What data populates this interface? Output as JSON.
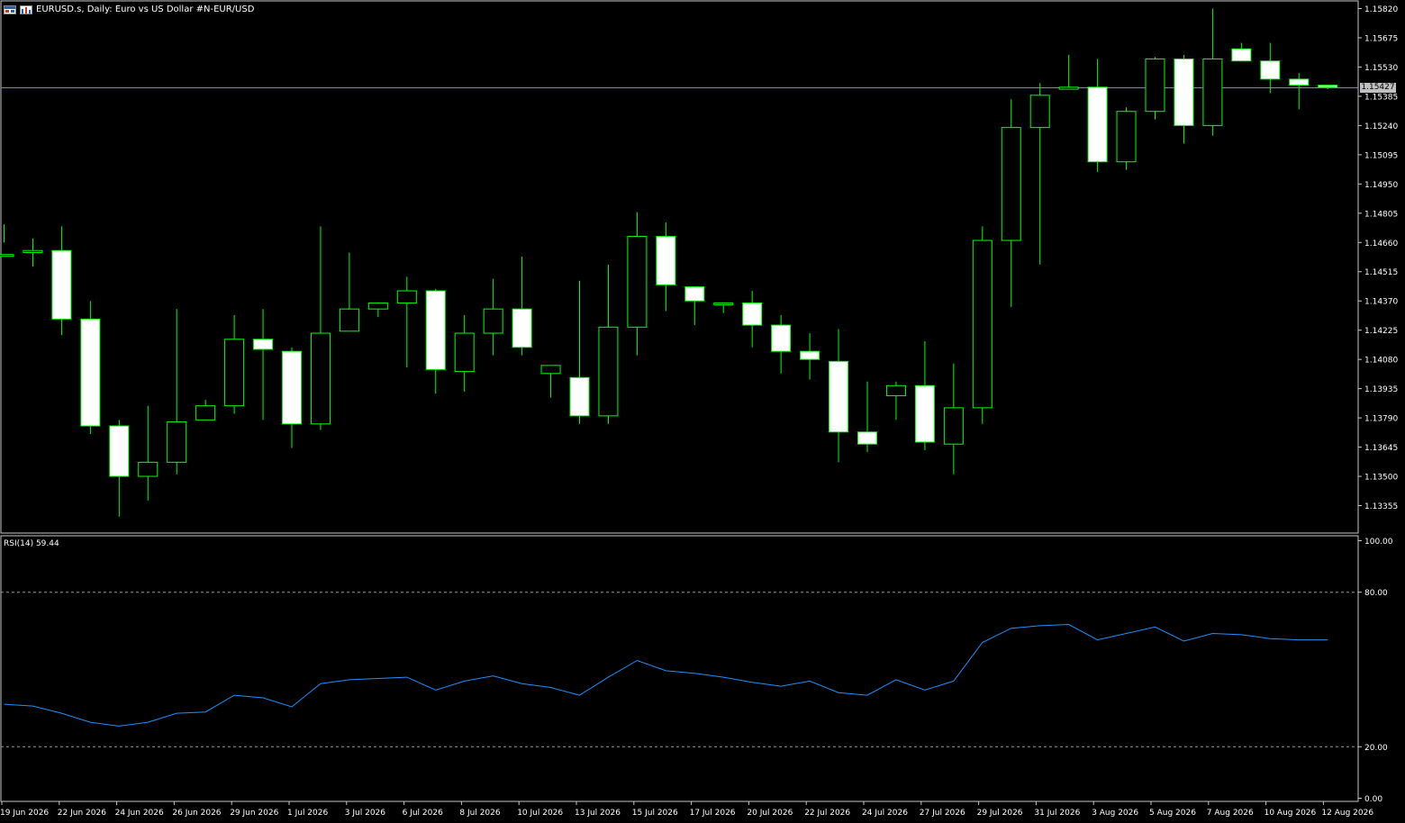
{
  "header": {
    "title": "EURUSD.s, Daily:  Euro vs US Dollar #N-EUR/USD",
    "window_icon": "window-icon",
    "chart_type_icon": "bar-chart-icon"
  },
  "current_price": "1.15427",
  "rsi": {
    "label": "RSI(14) 59.44"
  },
  "colors": {
    "background": "#000000",
    "bull_outline": "#00ff00",
    "body": "#ffffff",
    "rsi_line": "#1e90ff",
    "price_line": "#6f8fb0"
  },
  "chart_data": [
    {
      "type": "candlestick",
      "title": "EURUSD.s, Daily:  Euro vs US Dollar #N-EUR/USD",
      "ylim": [
        1.1328,
        1.1589
      ],
      "y_ticks": [
        "1.15820",
        "1.15675",
        "1.15530",
        "1.15385",
        "1.15240",
        "1.15095",
        "1.14950",
        "1.14805",
        "1.14660",
        "1.14515",
        "1.14370",
        "1.14225",
        "1.14080",
        "1.13935",
        "1.13790",
        "1.13645",
        "1.13500",
        "1.13355"
      ],
      "x_labels": [
        "19 Jun 2026",
        "22 Jun 2026",
        "24 Jun 2026",
        "26 Jun 2026",
        "29 Jun 2026",
        "1 Jul 2026",
        "3 Jul 2026",
        "6 Jul 2026",
        "8 Jul 2026",
        "10 Jul 2026",
        "13 Jul 2026",
        "15 Jul 2026",
        "17 Jul 2026",
        "20 Jul 2026",
        "22 Jul 2026",
        "24 Jul 2026",
        "27 Jul 2026",
        "29 Jul 2026",
        "31 Jul 2026",
        "3 Aug 2026",
        "5 Aug 2026",
        "7 Aug 2026",
        "10 Aug 2026",
        "12 Aug 2026"
      ],
      "current_price": 1.15427,
      "ohlc": [
        [
          1.146,
          1.1475,
          1.1466,
          1.146
        ],
        [
          1.1461,
          1.1468,
          1.1454,
          1.1462
        ],
        [
          1.1462,
          1.1474,
          1.142,
          1.1428
        ],
        [
          1.1428,
          1.1437,
          1.1371,
          1.1375
        ],
        [
          1.1375,
          1.1378,
          1.133,
          1.135
        ],
        [
          1.135,
          1.1385,
          1.1338,
          1.1357
        ],
        [
          1.1357,
          1.1433,
          1.1351,
          1.1377
        ],
        [
          1.1378,
          1.1388,
          1.1378,
          1.1385
        ],
        [
          1.1385,
          1.143,
          1.1381,
          1.1418
        ],
        [
          1.1418,
          1.1433,
          1.1378,
          1.1413
        ],
        [
          1.1412,
          1.1414,
          1.1364,
          1.1376
        ],
        [
          1.1376,
          1.1474,
          1.1373,
          1.1421
        ],
        [
          1.1422,
          1.1461,
          1.1422,
          1.1433
        ],
        [
          1.1433,
          1.1436,
          1.1429,
          1.1436
        ],
        [
          1.1436,
          1.1449,
          1.1404,
          1.1442
        ],
        [
          1.1442,
          1.1443,
          1.1391,
          1.1403
        ],
        [
          1.1402,
          1.143,
          1.1392,
          1.1421
        ],
        [
          1.1421,
          1.1448,
          1.141,
          1.1433
        ],
        [
          1.1433,
          1.1459,
          1.141,
          1.1414
        ],
        [
          1.1401,
          1.1405,
          1.1389,
          1.1405
        ],
        [
          1.1399,
          1.1447,
          1.1376,
          1.138
        ],
        [
          1.138,
          1.1455,
          1.1376,
          1.1424
        ],
        [
          1.1424,
          1.1481,
          1.141,
          1.1469
        ],
        [
          1.1469,
          1.1476,
          1.1432,
          1.1445
        ],
        [
          1.1444,
          1.1438,
          1.1425,
          1.1437
        ],
        [
          1.1436,
          1.1436,
          1.1431,
          1.1436
        ],
        [
          1.1436,
          1.1442,
          1.1414,
          1.1425
        ],
        [
          1.1425,
          1.143,
          1.1401,
          1.1412
        ],
        [
          1.1412,
          1.1421,
          1.1398,
          1.1408
        ],
        [
          1.1407,
          1.1423,
          1.1357,
          1.1372
        ],
        [
          1.1372,
          1.1397,
          1.1362,
          1.1366
        ],
        [
          1.139,
          1.1397,
          1.1378,
          1.1395
        ],
        [
          1.1395,
          1.1417,
          1.1363,
          1.1367
        ],
        [
          1.1366,
          1.1406,
          1.1351,
          1.1384
        ],
        [
          1.1384,
          1.1474,
          1.1376,
          1.1467
        ],
        [
          1.1467,
          1.1537,
          1.1434,
          1.1523
        ],
        [
          1.1523,
          1.1545,
          1.1455,
          1.1539
        ],
        [
          1.1542,
          1.1559,
          1.1542,
          1.1543
        ],
        [
          1.1543,
          1.1557,
          1.1501,
          1.1506
        ],
        [
          1.1506,
          1.1533,
          1.1502,
          1.1531
        ],
        [
          1.1531,
          1.1558,
          1.1527,
          1.1557
        ],
        [
          1.1557,
          1.1559,
          1.1515,
          1.1524
        ],
        [
          1.1524,
          1.1582,
          1.1519,
          1.1557
        ],
        [
          1.1562,
          1.1565,
          1.1556,
          1.1556
        ],
        [
          1.1556,
          1.1565,
          1.154,
          1.1547
        ],
        [
          1.1547,
          1.155,
          1.1532,
          1.1544
        ],
        [
          1.1544,
          1.1544,
          1.1542,
          1.1543
        ]
      ]
    },
    {
      "type": "line",
      "title": "RSI(14) 59.44",
      "ylim": [
        0,
        100
      ],
      "y_ticks": [
        "100.00",
        "80.00",
        "20.00",
        "0.00"
      ],
      "levels": [
        80,
        20
      ],
      "values": [
        36.5,
        35.8,
        33.0,
        29.5,
        28.0,
        29.5,
        33.0,
        33.5,
        40.0,
        39.0,
        35.5,
        44.5,
        46.0,
        46.5,
        47.0,
        42.0,
        45.5,
        47.5,
        44.5,
        43.0,
        40.0,
        47.0,
        53.5,
        49.5,
        48.5,
        47.0,
        45.0,
        43.5,
        45.5,
        41.0,
        40.0,
        46.0,
        42.0,
        45.5,
        60.5,
        66.0,
        67.0,
        67.5,
        61.5,
        64.0,
        66.5,
        61.0,
        64.0,
        63.5,
        62.0,
        61.5,
        61.5
      ]
    }
  ]
}
